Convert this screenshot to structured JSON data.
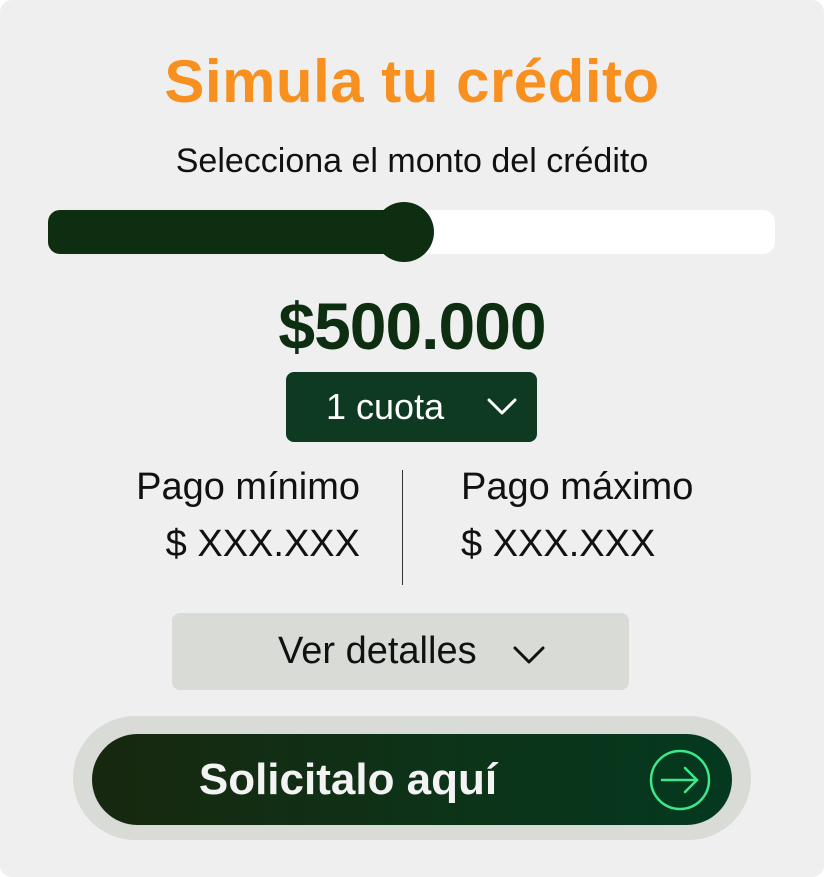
{
  "header": {
    "title": "Simula tu crédito",
    "subtitle": "Selecciona el monto del crédito"
  },
  "slider": {
    "level": 0.5
  },
  "amount": {
    "value": "$500.000"
  },
  "installments": {
    "selected": "1 cuota",
    "icon": "chevron-down-icon"
  },
  "payments": {
    "min_label": "Pago mínimo",
    "min_value": "$ XXX.XXX",
    "max_label": "Pago máximo",
    "max_value": "$ XXX.XXX"
  },
  "details": {
    "label": "Ver detalles",
    "icon": "chevron-down-icon"
  },
  "cta": {
    "label": "Solicitalo aquí",
    "icon": "arrow-right-circle-icon"
  },
  "colors": {
    "title": "#f7901e",
    "primary_dark_green": "#0e2e12",
    "select_green": "#0e3a21",
    "arrow_accent": "#3ee88a",
    "card_background": "#efefef",
    "secondary_button": "#d9dbd7"
  }
}
